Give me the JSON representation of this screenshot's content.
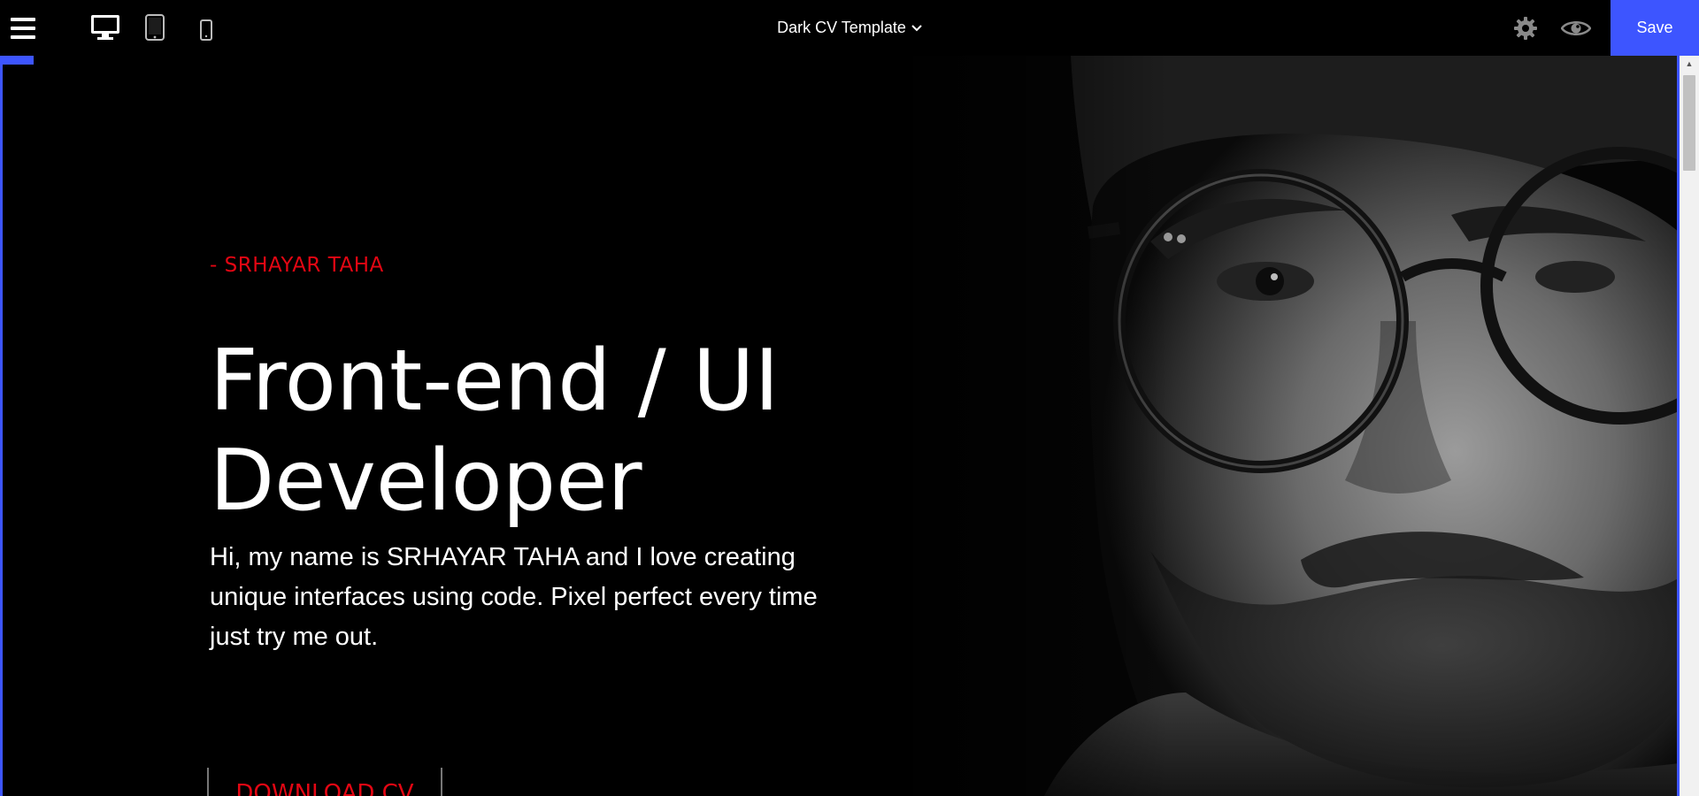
{
  "toolbar": {
    "menu_icon": "hamburger-menu-icon",
    "devices": [
      "desktop-icon",
      "tablet-icon",
      "mobile-icon"
    ],
    "template_title": "Dark CV Template",
    "settings_icon": "gear-icon",
    "preview_icon": "eye-icon",
    "save_label": "Save"
  },
  "hero": {
    "kicker": "- SRHAYAR TAHA",
    "headline_line1": "Front-end / UI",
    "headline_line2": "Developer",
    "intro": "Hi, my name is SRHAYAR TAHA and I love creating unique interfaces using code. Pixel perfect every time just try me out.",
    "download_label": "DOWNLOAD CV"
  },
  "colors": {
    "accent": "#3d55ff",
    "kicker_red": "#e30613",
    "background": "#000000"
  }
}
